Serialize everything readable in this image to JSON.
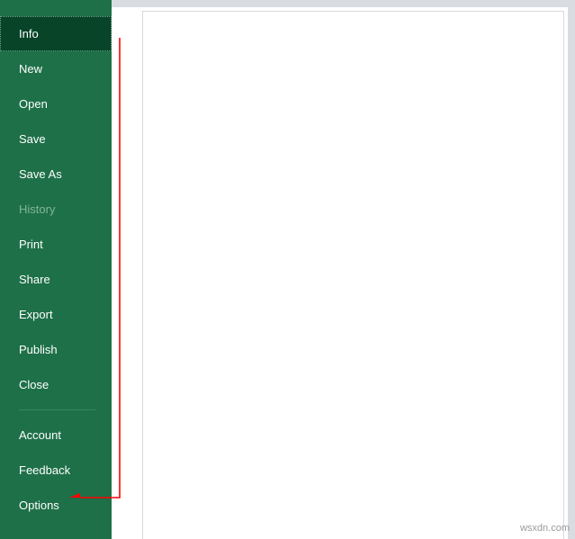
{
  "sidebar": {
    "items": [
      {
        "label": "Info",
        "state": "selected"
      },
      {
        "label": "New",
        "state": "normal"
      },
      {
        "label": "Open",
        "state": "normal"
      },
      {
        "label": "Save",
        "state": "normal"
      },
      {
        "label": "Save As",
        "state": "normal"
      },
      {
        "label": "History",
        "state": "disabled"
      },
      {
        "label": "Print",
        "state": "normal"
      },
      {
        "label": "Share",
        "state": "normal"
      },
      {
        "label": "Export",
        "state": "normal"
      },
      {
        "label": "Publish",
        "state": "normal"
      },
      {
        "label": "Close",
        "state": "normal"
      }
    ],
    "bottomItems": [
      {
        "label": "Account",
        "state": "normal"
      },
      {
        "label": "Feedback",
        "state": "normal"
      },
      {
        "label": "Options",
        "state": "normal"
      }
    ]
  },
  "colors": {
    "sidebarBg": "#1e7048",
    "selectedBg": "#074428",
    "arrow": "#ff0000"
  },
  "watermark": "wsxdn.com"
}
